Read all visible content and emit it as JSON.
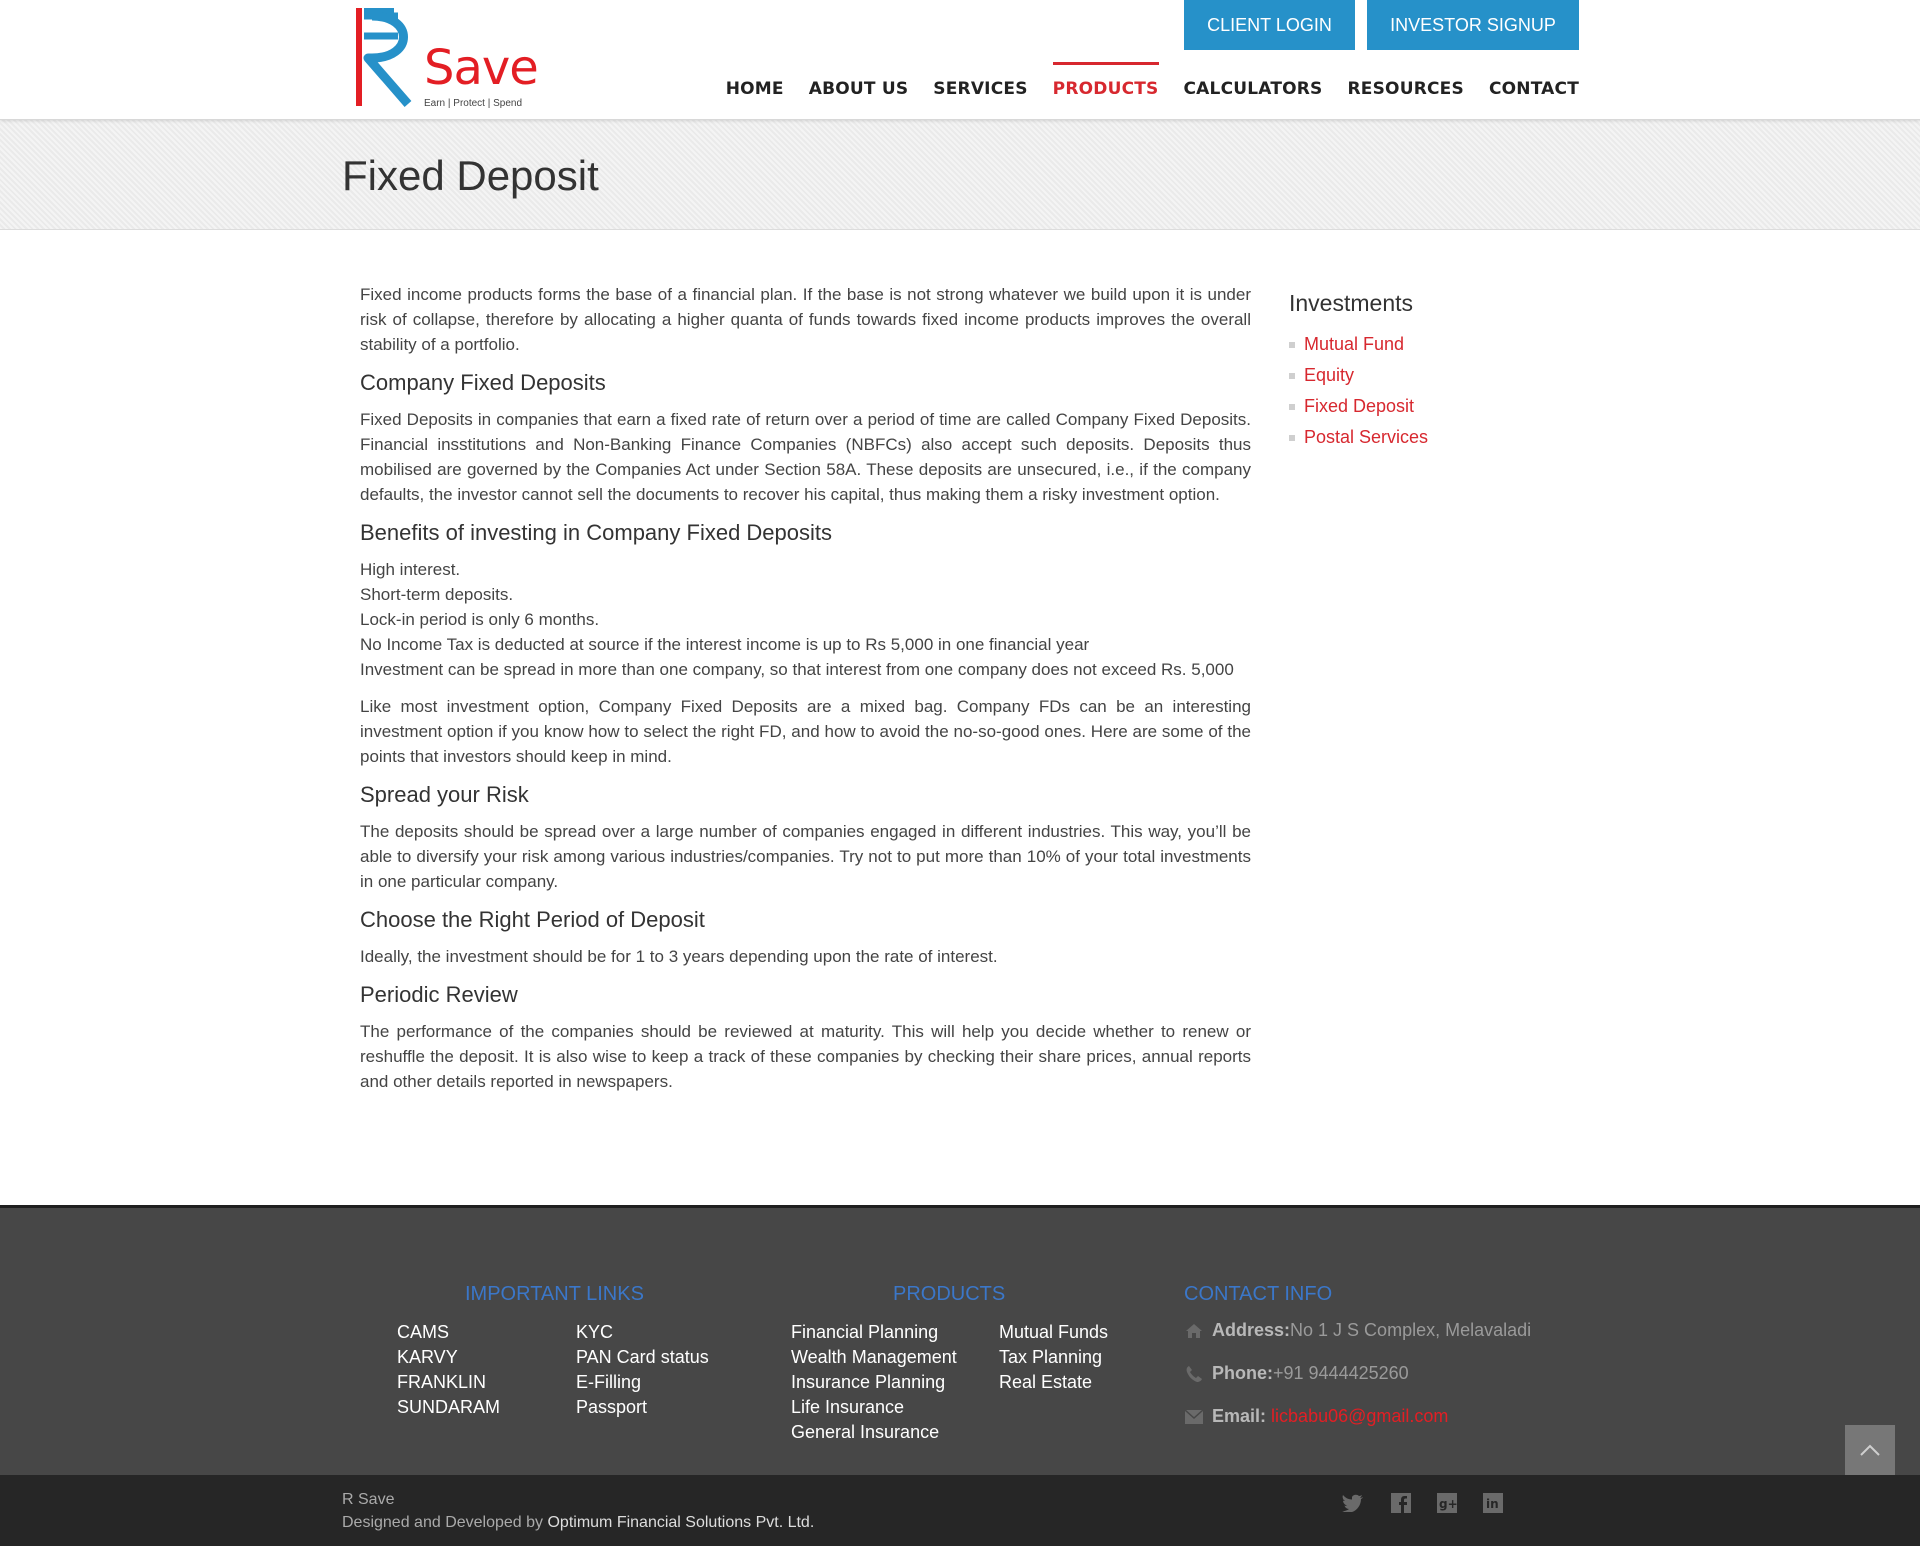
{
  "header": {
    "logo_text": "Save",
    "logo_tagline": "Earn | Protect | Spend",
    "client_login": "CLIENT LOGIN",
    "investor_signup": "INVESTOR SIGNUP",
    "nav": [
      {
        "label": "HOME"
      },
      {
        "label": "ABOUT US"
      },
      {
        "label": "SERVICES"
      },
      {
        "label": "PRODUCTS"
      },
      {
        "label": "CALCULATORS"
      },
      {
        "label": "RESOURCES"
      },
      {
        "label": "CONTACT"
      }
    ],
    "active_nav": "PRODUCTS"
  },
  "page_title": "Fixed Deposit",
  "content": {
    "intro": "Fixed income products forms the base of a financial plan. If the base is not strong whatever we build upon it is under risk of collapse, therefore by allocating a higher quanta of funds towards fixed income products improves the overall stability of a portfolio.",
    "h_company": "Company Fixed Deposits",
    "p_company": "Fixed Deposits in companies that earn a fixed rate of return over a period of time are called Company Fixed Deposits. Financial insstitutions and Non-Banking Finance Companies (NBFCs) also accept such deposits. Deposits thus mobilised are governed by the Companies Act under Section 58A. These deposits are unsecured, i.e., if the company defaults, the investor cannot sell the documents to recover his capital, thus making them a risky investment option.",
    "h_benefits": "Benefits of investing in Company Fixed Deposits",
    "benefits": [
      "High interest.",
      "Short-term deposits.",
      "Lock-in period is only 6 months.",
      "No Income Tax is deducted at source if the interest income is up to Rs 5,000 in one financial year",
      "Investment can be spread in more than one company, so that interest from one company does not exceed Rs. 5,000"
    ],
    "p_mixed": "Like most investment option, Company Fixed Deposits are a mixed bag. Company FDs can be an interesting investment option if you know how to select the right FD, and how to avoid the no-so-good ones. Here are some of the points that investors should keep in mind.",
    "h_spread": "Spread your Risk",
    "p_spread": "The deposits should be spread over a large number of companies engaged in different industries. This way, you’ll be able to diversify your risk among various industries/companies. Try not to put more than 10% of your total investments in one particular company.",
    "h_period": "Choose the Right Period of Deposit",
    "p_period": "Ideally, the investment should be for 1 to 3 years depending upon the rate of interest.",
    "h_review": "Periodic Review",
    "p_review": "The performance of the companies should be reviewed at maturity. This will help you decide whether to renew or reshuffle the deposit. It is also wise to keep a track of these companies by checking their share prices, annual reports and other details reported in newspapers."
  },
  "sidebar": {
    "title": "Investments",
    "links": [
      "Mutual Fund",
      "Equity",
      "Fixed Deposit",
      "Postal Services"
    ]
  },
  "footer": {
    "important_links_title": "IMPORTANT LINKS",
    "links_col1": [
      "CAMS",
      "KARVY",
      "FRANKLIN",
      "SUNDARAM"
    ],
    "links_col2": [
      "KYC",
      "PAN Card status",
      "E-Filling",
      "Passport"
    ],
    "products_title": "PRODUCTS",
    "products_col1": [
      "Financial Planning",
      "Wealth Management",
      "Insurance Planning",
      "Life Insurance",
      "General Insurance"
    ],
    "products_col2": [
      "Mutual Funds",
      "Tax Planning",
      "Real Estate"
    ],
    "contact_title": "CONTACT INFO",
    "address_label": "Address:",
    "address_value": "No 1 J S Complex, Melavaladi",
    "phone_label": "Phone:",
    "phone_value": "+91 9444425260",
    "email_label": "Email:",
    "email_value": "licbabu06@gmail.com"
  },
  "bottom": {
    "brand": "R Save",
    "designed_by": "Designed and Developed by ",
    "developer": "Optimum Financial Solutions Pvt. Ltd."
  },
  "icons": {
    "address": "home-icon",
    "phone": "phone-icon",
    "email": "envelope-icon",
    "to_top": "chevron-up-icon",
    "social": [
      "twitter-icon",
      "facebook-icon",
      "google-plus-icon",
      "linkedin-icon"
    ]
  },
  "colors": {
    "brand_red": "#d7282f",
    "brand_blue": "#2691c9",
    "footer_heading": "#3b77c9",
    "footer_bg": "#474747",
    "bottombar_bg": "#262626"
  }
}
